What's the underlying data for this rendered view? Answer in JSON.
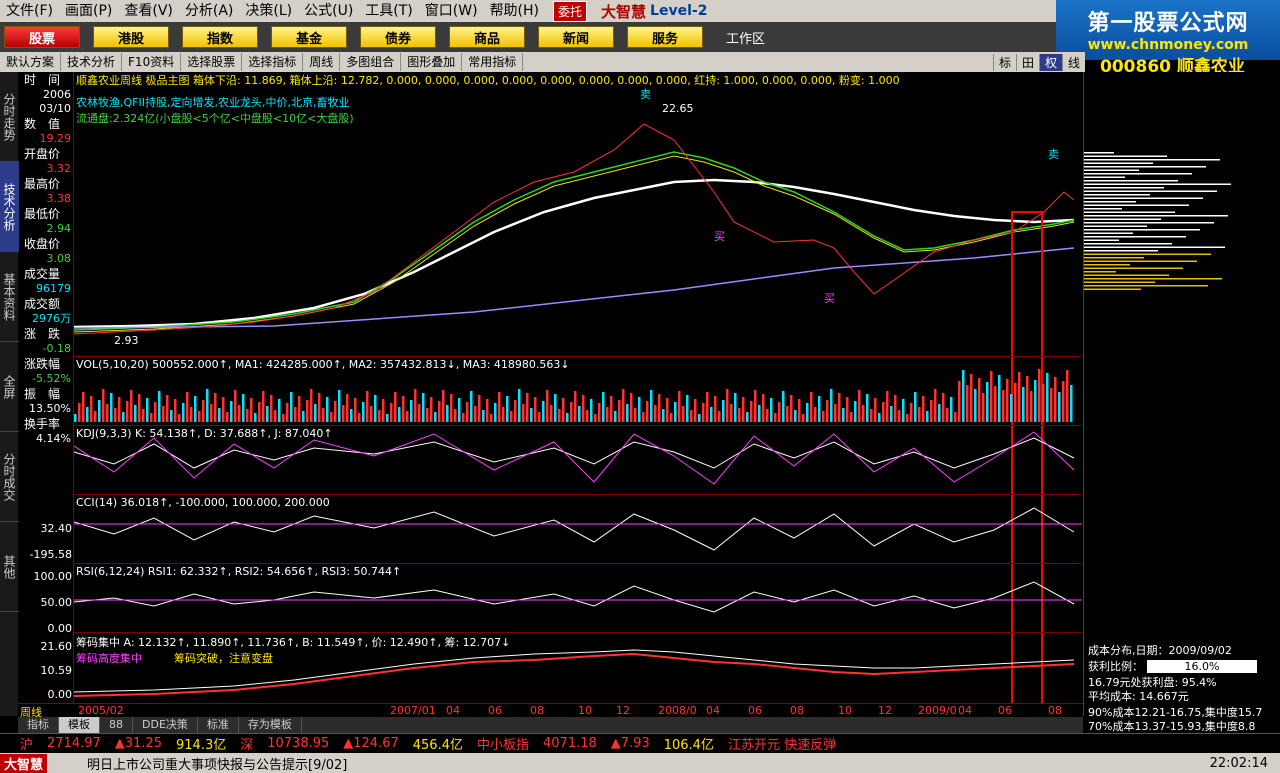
{
  "menu": {
    "items": [
      "文件(F)",
      "画面(P)",
      "查看(V)",
      "分析(A)",
      "决策(L)",
      "公式(U)",
      "工具(T)",
      "窗口(W)",
      "帮助(H)"
    ],
    "consign": "委托",
    "brand": "大智慧",
    "level": "Level-2"
  },
  "watermark": {
    "title": "第一股票公式网",
    "url": "www.chnmoney.com"
  },
  "nav": {
    "buttons": [
      "股票",
      "港股",
      "指数",
      "基金",
      "债券",
      "商品",
      "新闻",
      "服务"
    ],
    "workspace": "工作区"
  },
  "toolbar2": {
    "items": [
      "默认方案",
      "技术分析",
      "F10资料",
      "选择股票",
      "选择指标",
      "周线",
      "多图组合",
      "图形叠加",
      "常用指标"
    ],
    "right": [
      "标",
      "田",
      "权",
      "线"
    ]
  },
  "stock": {
    "code": "000860",
    "name": "顺鑫农业"
  },
  "left_tabs": [
    "分时走势",
    "技术分析",
    "基本资料",
    "全屏",
    "分时成交",
    "其他"
  ],
  "info": [
    {
      "label": "时　间",
      "value": "2006",
      "color": "white"
    },
    {
      "label": "",
      "value": "03/10",
      "color": "white"
    },
    {
      "label": "数　值",
      "value": "19.29",
      "color": "red"
    },
    {
      "label": "开盘价",
      "value": "3.32",
      "color": "red"
    },
    {
      "label": "最高价",
      "value": "3.38",
      "color": "red"
    },
    {
      "label": "最低价",
      "value": "2.94",
      "color": "green"
    },
    {
      "label": "收盘价",
      "value": "3.08",
      "color": "green"
    },
    {
      "label": "成交量",
      "value": "96179",
      "color": "cyan"
    },
    {
      "label": "成交额",
      "value": "2976万",
      "color": "cyan"
    },
    {
      "label": "涨　跌",
      "value": "-0.18",
      "color": "green"
    },
    {
      "label": "涨跌幅",
      "value": "-5.52%",
      "color": "green"
    },
    {
      "label": "振　幅",
      "value": "13.50%",
      "color": "white"
    },
    {
      "label": "换手率",
      "value": "4.14%",
      "color": "white"
    }
  ],
  "main_chart": {
    "header": "顺鑫农业周线 极品主图  箱体下沿: 11.869, 箱体上沿: 12.782, 0.000, 0.000, 0.000, 0.000, 0.000, 0.000, 0.000, 0.000, 红持: 1.000, 0.000, 0.000, 粉变: 1.000",
    "tags": "农林牧渔,QFII持股,定向增发,农业龙头,中价,北京,畜牧业",
    "float": "流通盘:2.324亿(小盘股<5个亿<中盘股<10亿<大盘股)",
    "peak_label": "22.65",
    "low_label": "2.93",
    "buy_label": "买",
    "sell_label": "卖"
  },
  "panels": {
    "vol": "VOL(5,10,20) 500552.000↑, MA1: 424285.000↑, MA2: 357432.813↓, MA3: 418980.563↓",
    "kdj": "KDJ(9,3,3) K: 54.138↑, D: 37.688↑, J: 87.040↑",
    "cci": "CCI(14) 36.018↑, -100.000, 100.000, 200.000",
    "rsi": "RSI(6,12,24) RSI1: 62.332↑, RSI2: 54.656↑, RSI3: 50.744↑",
    "chip": "筹码集中 A: 12.132↑, 11.890↑, 11.736↑, B: 11.549↑, 价: 12.490↑, 筹: 12.707↓",
    "chip_legend1": "筹码高度集中",
    "chip_legend2": "筹码突破，注意变盘",
    "cci_axis": [
      "32.40",
      "-195.58"
    ],
    "rsi_axis": [
      "100.00",
      "50.00",
      "0.00"
    ],
    "chip_axis": [
      "21.60",
      "10.59",
      "0.00"
    ]
  },
  "xaxis": {
    "period": "周线",
    "labels": [
      "2005/02",
      "2007/01",
      "04",
      "06",
      "08",
      "10",
      "12",
      "2008/0",
      "04",
      "06",
      "08",
      "10",
      "12",
      "2009/0",
      "04",
      "06",
      "08"
    ]
  },
  "right_panel": {
    "cost_title": "成本分布,日期：2009/09/02",
    "profit_label": "获利比例：",
    "profit_value": "16.0%",
    "profit_line": "16.79元处获利盘: 95.4%",
    "avg_cost": "平均成本: 14.667元",
    "cost90": "90%成本12.21-16.75,集中度15.7",
    "cost70": "70%成本13.37-15.93,集中度8.8"
  },
  "bottom_tabs": [
    "指标",
    "模板",
    "88",
    "DDE决策",
    "标准",
    "存为模板"
  ],
  "ticker": {
    "sh_label": "沪",
    "sh_index": "2714.97",
    "sh_change": "▲31.25",
    "sh_amount": "914.3亿",
    "sz_label": "深",
    "sz_index": "10738.95",
    "sz_change": "▲124.67",
    "sz_amount": "456.4亿",
    "sme_label": "中小板指",
    "sme_index": "4071.18",
    "sme_change": "▲7.93",
    "sme_amount": "106.4亿",
    "news": "江苏开元 快速反弹"
  },
  "status": {
    "brand": "大智慧",
    "notice": "明日上市公司重大事项快报与公告提示[9/02]",
    "time": "22:02:14"
  },
  "colors": {
    "up": "#ff3232",
    "down": "#00e5ff",
    "nav_active": "#c00000",
    "highlight_box": "#ff0000"
  }
}
